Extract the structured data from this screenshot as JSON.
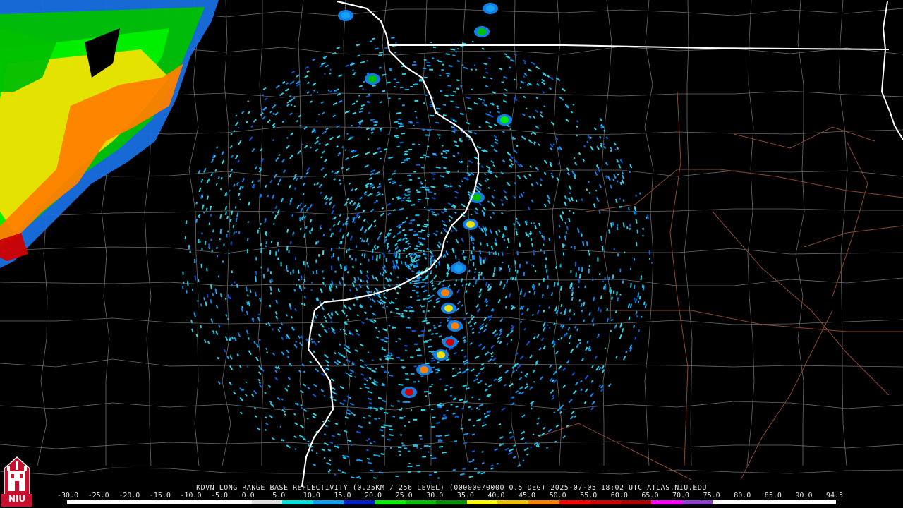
{
  "product": {
    "station": "KDVN",
    "caption": "KDVN LONG RANGE BASE REFLECTIVITY (0.25KM / 256 LEVEL) (000000/0000 0.5 DEG) 2025-07-05 18:02 UTC  ATLAS.NIU.EDU"
  },
  "legend": {
    "ticks": [
      "-30.0",
      "-25.0",
      "-20.0",
      "-15.0",
      "-10.0",
      "-5.0",
      "0.0",
      "5.0",
      "10.0",
      "15.0",
      "20.0",
      "25.0",
      "30.0",
      "35.0",
      "40.0",
      "45.0",
      "50.0",
      "55.0",
      "60.0",
      "65.0",
      "70.0",
      "75.0",
      "80.0",
      "85.0",
      "90.0",
      "94.5"
    ],
    "colors": [
      "#ffffff",
      "#ffffff",
      "#ffffff",
      "#ffffff",
      "#ffffff",
      "#ffffff",
      "#e0e0e0",
      "#00e0e0",
      "#10a0f0",
      "#0020d0",
      "#00f000",
      "#00c000",
      "#009000",
      "#ffff00",
      "#f0c000",
      "#ff8000",
      "#ff0000",
      "#d00000",
      "#b00000",
      "#ff00ff",
      "#9040d0",
      "#ffffff",
      "#ffffff",
      "#ffffff",
      "#ffffff"
    ]
  },
  "logo": {
    "text": "NIU",
    "icon": "niu-castle-icon"
  },
  "map": {
    "state_border_color": "#ffffff",
    "county_line_color": "#6a6a6a",
    "highway_color": "#8a4a30"
  }
}
